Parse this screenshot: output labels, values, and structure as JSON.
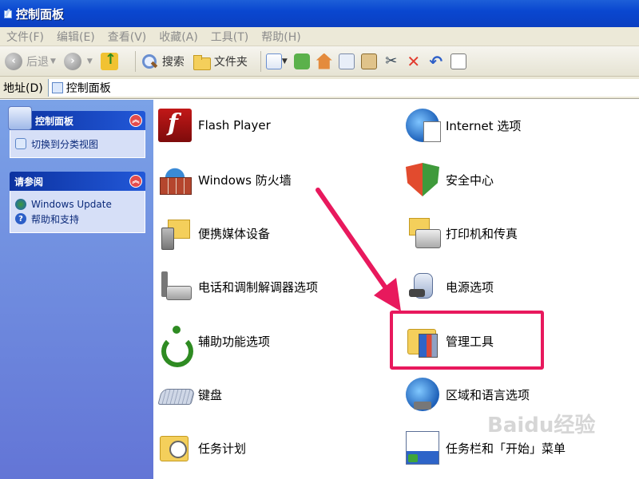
{
  "window": {
    "title": "控制面板"
  },
  "menu": [
    "文件(F)",
    "编辑(E)",
    "查看(V)",
    "收藏(A)",
    "工具(T)",
    "帮助(H)"
  ],
  "toolbar": {
    "back": "后退",
    "search": "搜索",
    "folders": "文件夹"
  },
  "address": {
    "label": "地址(D)",
    "value": "控制面板"
  },
  "sidebar": {
    "panels": [
      {
        "title": "控制面板",
        "items": [
          "切换到分类视图"
        ]
      },
      {
        "title": "请参阅",
        "items": [
          "Windows Update",
          "帮助和支持"
        ]
      }
    ]
  },
  "items": {
    "left": [
      "Flash Player",
      "Windows 防火墙",
      "便携媒体设备",
      "电话和调制解调器选项",
      "辅助功能选项",
      "键盘",
      "任务计划"
    ],
    "right": [
      "Internet 选项",
      "安全中心",
      "打印机和传真",
      "电源选项",
      "管理工具",
      "区域和语言选项",
      "任务栏和「开始」菜单"
    ]
  },
  "highlight": {
    "target": "管理工具",
    "color": "#e8195d"
  },
  "watermark": "Baidu经验",
  "colors": {
    "title_bar": "#0a47d0",
    "sidebar": "#7ba2e7",
    "annotation": "#e8195d"
  }
}
